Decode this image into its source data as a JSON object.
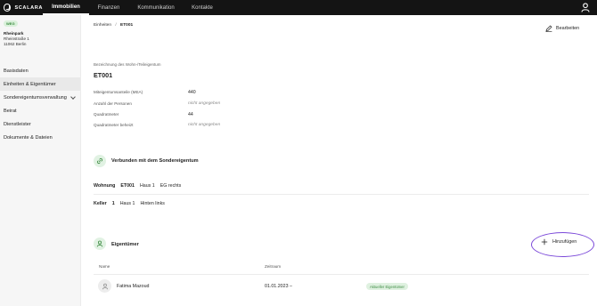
{
  "app": {
    "brand": "SCALARA",
    "nav": [
      "Immobilien",
      "Finanzen",
      "Kommunikation",
      "Kontakte"
    ],
    "active_nav": "Immobilien"
  },
  "sidebar": {
    "badge": "WEG",
    "property_name": "Rheinpark",
    "street": "Rheinstraße 1",
    "city": "11062 Berlin",
    "items": [
      {
        "label": "Basisdaten"
      },
      {
        "label": "Einheiten & Eigentümer"
      },
      {
        "label": "Sondereigentumsverwaltung"
      },
      {
        "label": "Beirat"
      },
      {
        "label": "Dienstleister"
      },
      {
        "label": "Dokumente & Dateien"
      }
    ]
  },
  "breadcrumb": {
    "parent": "Einheiten",
    "separator": "/",
    "current": "ET001"
  },
  "header": {
    "edit_label": "Bearbeiten"
  },
  "unit": {
    "caption": "Bezeichnung des Wohn-/Teileigentum",
    "title": "ET001",
    "rows": [
      {
        "label": "Miteigentumsanteile (MEA)",
        "value": "440"
      },
      {
        "label": "Anzahl der Personen",
        "value": "nicht angegeben"
      },
      {
        "label": "Quadratmeter",
        "value": "44"
      },
      {
        "label": "Quadratmeter beheizt",
        "value": "nicht angegeben"
      }
    ]
  },
  "linked": {
    "title": "Verbunden mit dem Sondereigentum",
    "items": [
      {
        "type": "Wohnung",
        "id": "ET001",
        "building": "Haus 1",
        "location": "EG rechts"
      },
      {
        "type": "Keller",
        "id": "1",
        "building": "Haus 1",
        "location": "Hinten links"
      }
    ]
  },
  "owners": {
    "title": "Eigentümer",
    "add_label": "Hinzufügen",
    "columns": {
      "name": "Name",
      "period": "Zeitraum"
    },
    "rows": [
      {
        "name": "Fatima Mazoud",
        "period": "01.01.2023 –",
        "status": "Aktueller Eigentümer"
      }
    ]
  },
  "colors": {
    "topbar": "#141414",
    "accent_green": "#3a8a3f",
    "highlight_ring": "#7b49d9"
  }
}
